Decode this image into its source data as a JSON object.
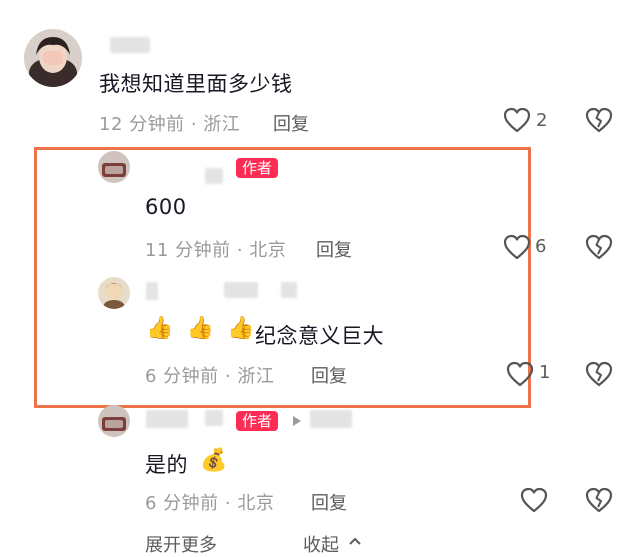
{
  "comments": [
    {
      "text": "我想知道里面多少钱",
      "time": "12 分钟前 · 浙江",
      "reply": "回复",
      "likes": "2",
      "like_icon": "heart-outline-icon",
      "dislike_icon": "broken-heart-icon"
    },
    {
      "badge": "作者",
      "text": "600",
      "time": "11 分钟前 · 北京",
      "reply": "回复",
      "likes": "6"
    },
    {
      "emojis": [
        "👍",
        "👍",
        "👍"
      ],
      "text": "纪念意义巨大",
      "time": "6 分钟前 · 浙江",
      "reply": "回复",
      "likes": "1"
    },
    {
      "badge": "作者",
      "text": "是的",
      "emoji": "💰",
      "time": "6 分钟前 · 北京",
      "reply": "回复",
      "likes": ""
    }
  ],
  "footer": {
    "expand": "展开更多",
    "collapse": "收起"
  },
  "colors": {
    "highlight_border": "#ec7446",
    "badge": "#fe2c55",
    "meta_text": "#9a9a9a"
  }
}
